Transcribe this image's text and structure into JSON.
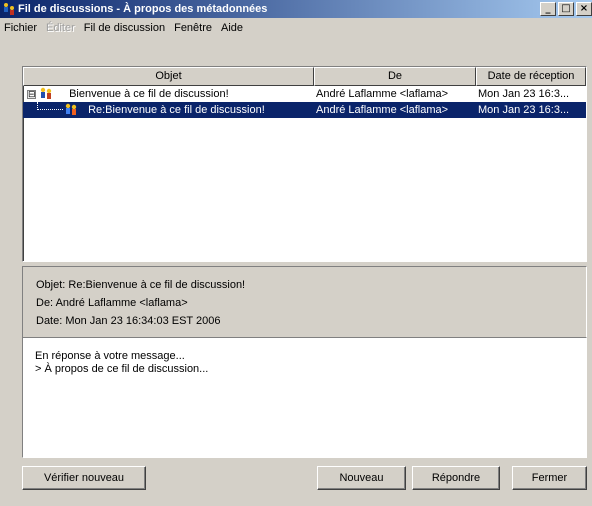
{
  "window": {
    "title": "Fil de discussions - À propos des métadonnées",
    "controls": {
      "minimize": "_",
      "maximize": "□",
      "close": "×"
    }
  },
  "menubar": {
    "items": [
      {
        "label": "Fichier",
        "enabled": true
      },
      {
        "label": "Éditer",
        "enabled": false
      },
      {
        "label": "Fil de discussion",
        "enabled": true
      },
      {
        "label": "Fenêtre",
        "enabled": true
      },
      {
        "label": "Aide",
        "enabled": true
      }
    ]
  },
  "table": {
    "columns": [
      "Objet",
      "De",
      "Date de réception"
    ],
    "rows": [
      {
        "subject": "Bienvenue à ce fil de discussion!",
        "from": "André Laflamme <laflama>",
        "date": "Mon Jan 23 16:3...",
        "tree": "⊟",
        "selected": false
      },
      {
        "subject": "Re:Bienvenue à ce fil de discussion!",
        "from": "André Laflamme <laflama>",
        "date": "Mon Jan 23 16:3...",
        "selected": true
      }
    ]
  },
  "details": {
    "subject": "Objet: Re:Bienvenue à ce fil de discussion!",
    "from": "De: André Laflamme <laflama>",
    "date": "Date: Mon Jan 23 16:34:03 EST 2006"
  },
  "message": {
    "lines": [
      "En réponse à votre message...",
      "> À propos de ce fil de discussion..."
    ]
  },
  "buttons": {
    "check": "Vérifier nouveau",
    "new": "Nouveau",
    "reply": "Répondre",
    "close": "Fermer"
  },
  "icons": {
    "app": "people-thread-icon",
    "message": "message-node-icon"
  },
  "colors": {
    "selection": "#0a246a",
    "face": "#d4d0c8"
  }
}
